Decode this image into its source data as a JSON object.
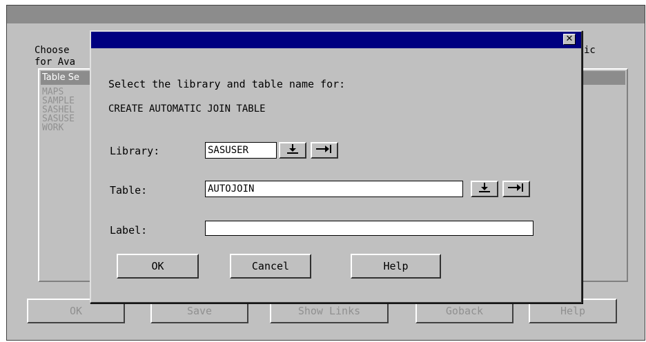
{
  "background_window": {
    "prompt_line1": "Choose",
    "prompt_line2": "for Ava",
    "prompt_right": "ic",
    "list_header": "Table Se",
    "list_items": [
      "MAPS",
      "SAMPLE",
      "SASHEL",
      "SASUSE",
      "WORK"
    ],
    "buttons": {
      "ok": "OK",
      "save": "Save",
      "show_links": "Show Links",
      "goback": "Goback",
      "help": "Help"
    }
  },
  "dialog": {
    "close_icon": "close-icon",
    "instruction": "Select the library and table name for:",
    "subtitle": "CREATE AUTOMATIC JOIN TABLE",
    "library_label": "Library:",
    "library_value": "SASUSER",
    "table_label": "Table:",
    "table_value": "AUTOJOIN",
    "label_label": "Label:",
    "label_value": "",
    "buttons": {
      "ok": "OK",
      "cancel": "Cancel",
      "help": "Help"
    },
    "icons": {
      "dropdown": "down-arrow-icon",
      "select": "right-arrow-icon"
    }
  },
  "colors": {
    "titlebar_active": "#000080",
    "titlebar_inactive": "#8c8c8c",
    "window_bg": "#c0c0c0",
    "disabled_text": "#909090"
  }
}
